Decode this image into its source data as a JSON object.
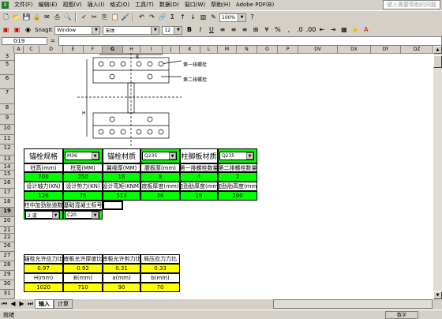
{
  "menubar": {
    "items": [
      "文件(F)",
      "编辑(E)",
      "视图(V)",
      "插入(I)",
      "格式(O)",
      "工具(T)",
      "数据(D)",
      "窗口(W)",
      "帮助(H)",
      "Adobe PDF(B)"
    ],
    "help_placeholder": "键入需要帮助的问题"
  },
  "toolbar": {
    "zoom": "100%",
    "snagit": "SnagIt",
    "window": "Window",
    "font": "宋体",
    "font_size": "12"
  },
  "namebar": {
    "cell_ref": "G19",
    "fx": "="
  },
  "columns": [
    "A",
    "C",
    "D",
    "E",
    "F",
    "G",
    "H",
    "I",
    "J",
    "K",
    "L",
    "M",
    "N",
    "O",
    "P",
    "DV",
    "DX",
    "DY",
    "DZ"
  ],
  "rows": [
    "3",
    "5",
    "6",
    "7",
    "8",
    "9",
    "10",
    "11",
    "12",
    "13",
    "14",
    "15",
    "16",
    "17",
    "18",
    "19",
    "20",
    "21",
    "22",
    "26",
    "27",
    "28",
    "29",
    "30",
    "31"
  ],
  "drawing": {
    "label_top": "B",
    "label_row1": "第一排螺栓",
    "label_row2": "第二排螺栓",
    "label_h": "H"
  },
  "top_table": {
    "label_anchor_spec": "锚栓规格",
    "anchor_spec": "M36",
    "label_anchor_mat": "锚栓材质",
    "anchor_mat": "Q235",
    "label_plate_mat": "柱脚板材质",
    "plate_mat": "Q235",
    "headers1": [
      "柱高(mm)",
      "柱宽(MM)",
      "翼缘厚(MM)",
      "腹板厚(mm)",
      "第一排螺栓数量",
      "第二排螺栓数量"
    ],
    "values1": [
      "700",
      "250",
      "16",
      "8",
      "4",
      "2"
    ],
    "headers2": [
      "设计轴力(KN)",
      "设计剪力(KN)",
      "设计弯矩(KNM)",
      "底板厚度(mm)",
      "加劲肋厚度(mm)",
      "加劲肋高度(mm)"
    ],
    "values2": [
      "126",
      "75",
      "513",
      "36",
      "19",
      "200"
    ],
    "label_stiffeners": "柱中加劲肋道数",
    "label_concrete": "基础混凝土标号",
    "stiffeners": "2 道",
    "concrete": "C20"
  },
  "bottom_table": {
    "headers": [
      "锚栓允许应力比",
      "底板允许厚度比",
      "底板允许剪力比",
      "局压应力力比"
    ],
    "ratios": [
      "0.97",
      "0.92",
      "0.31",
      "0.33"
    ],
    "labels": [
      "H(mm)",
      "B(mm)",
      "a(mm)",
      "b(mm)"
    ],
    "values": [
      "1020",
      "710",
      "90",
      "70"
    ]
  },
  "sheets": {
    "sheet1": "输入",
    "sheet2": "计算"
  },
  "status": {
    "ready": "就绪",
    "num": "数字"
  }
}
